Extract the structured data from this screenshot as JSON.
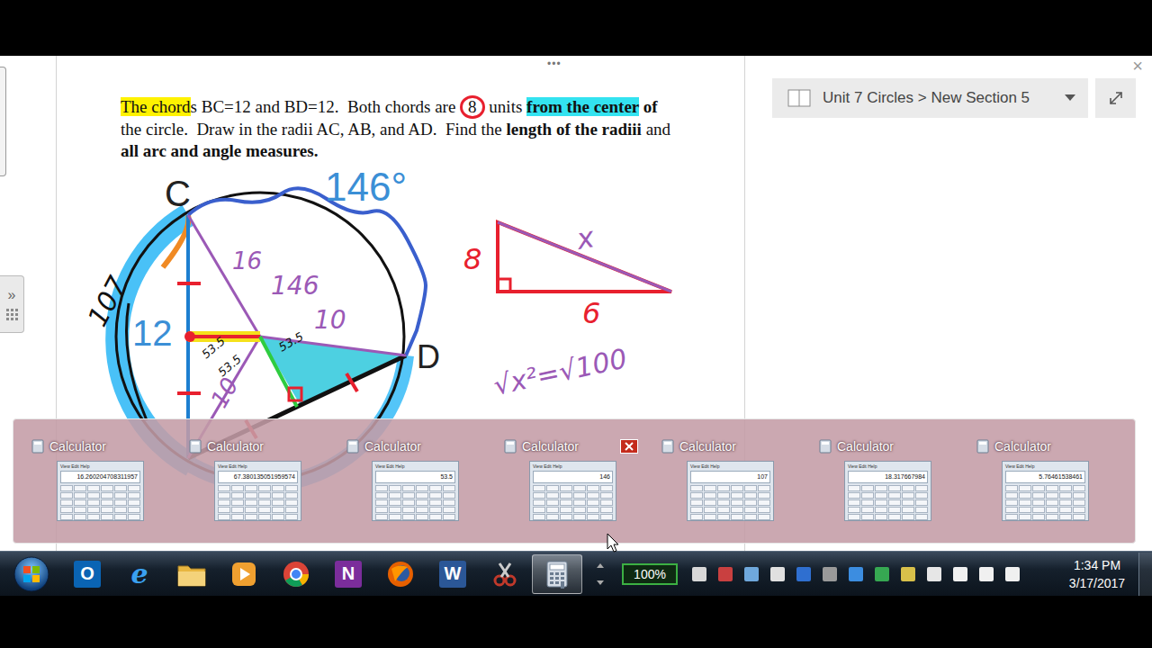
{
  "window": {
    "more": "•••",
    "close": "×",
    "expand_glyph": "»"
  },
  "problem": {
    "segments": [
      {
        "text": "The chord",
        "highlight": "yellow",
        "bold": false,
        "circled": false
      },
      {
        "text": "s BC=12 and BD=12.  Both chords are ",
        "highlight": "none",
        "bold": false,
        "circled": false
      },
      {
        "text": "8",
        "highlight": "none",
        "bold": false,
        "circled": true
      },
      {
        "text": " units ",
        "highlight": "none",
        "bold": false,
        "circled": false
      },
      {
        "text": "from the center",
        "highlight": "cyan",
        "bold": true,
        "circled": false
      },
      {
        "text": " of",
        "highlight": "none",
        "bold": true,
        "circled": false
      },
      {
        "text": " the circle.  Draw in the radii AC, AB, and AD.  Find the ",
        "highlight": "none",
        "bold": false,
        "circled": false
      },
      {
        "text": "length of the radiii",
        "highlight": "none",
        "bold": true,
        "circled": false
      },
      {
        "text": " and ",
        "highlight": "none",
        "bold": false,
        "circled": false
      },
      {
        "text": "all arc and angle measures.",
        "highlight": "none",
        "bold": true,
        "circled": false
      }
    ]
  },
  "diagram": {
    "labels": [
      {
        "text": "C"
      },
      {
        "text": "D"
      },
      {
        "text": "146°"
      },
      {
        "text": "12"
      }
    ],
    "annotations": [
      {
        "text": "107",
        "color": "#111111"
      },
      {
        "text": "16",
        "color": "#9b59b6"
      },
      {
        "text": "146",
        "color": "#9b59b6"
      },
      {
        "text": "10",
        "color": "#9b59b6"
      },
      {
        "text": "10",
        "color": "#9b59b6"
      },
      {
        "text": "53.5",
        "color": "#111111"
      },
      {
        "text": "53.5",
        "color": "#111111"
      },
      {
        "text": "53.5",
        "color": "#111111"
      },
      {
        "text": "8",
        "color": "#e8202e"
      },
      {
        "text": "x",
        "color": "#9b59b6"
      },
      {
        "text": "6",
        "color": "#e8202e"
      },
      {
        "text": "√x²=√100",
        "color": "#9b59b6"
      }
    ]
  },
  "breadcrumb": {
    "text": "Unit 7 Circles > New Section 5"
  },
  "thumbnail_menu": "View Edit Help",
  "thumbnails": [
    {
      "title": "Calculator",
      "display": "16.260204708311957",
      "hovered": false
    },
    {
      "title": "Calculator",
      "display": "67.380135051959574",
      "hovered": false
    },
    {
      "title": "Calculator",
      "display": "53.5",
      "hovered": false
    },
    {
      "title": "Calculator",
      "display": "146",
      "hovered": true
    },
    {
      "title": "Calculator",
      "display": "107",
      "hovered": false
    },
    {
      "title": "Calculator",
      "display": "18.317667984",
      "hovered": false
    },
    {
      "title": "Calculator",
      "display": "5.76461538461",
      "hovered": false
    }
  ],
  "taskbar": {
    "apps": [
      {
        "kind": "outlook",
        "glyph": "O",
        "active": false
      },
      {
        "kind": "ie",
        "glyph": "e",
        "active": false
      },
      {
        "kind": "explorer",
        "glyph": "",
        "active": false
      },
      {
        "kind": "media",
        "glyph": "",
        "active": false
      },
      {
        "kind": "chrome",
        "glyph": "",
        "active": false
      },
      {
        "kind": "onenote",
        "glyph": "N",
        "active": false
      },
      {
        "kind": "firefox",
        "glyph": "",
        "active": false
      },
      {
        "kind": "word",
        "glyph": "W",
        "active": false
      },
      {
        "kind": "snipping",
        "glyph": "",
        "active": false
      },
      {
        "kind": "calculator",
        "glyph": "",
        "active": true
      }
    ],
    "battery": "100%",
    "tray": [
      {
        "kind": "power"
      },
      {
        "kind": "keyboard"
      },
      {
        "kind": "book"
      },
      {
        "kind": "flag"
      },
      {
        "kind": "bluetooth"
      },
      {
        "kind": "network"
      },
      {
        "kind": "update"
      },
      {
        "kind": "shield"
      },
      {
        "kind": "security"
      },
      {
        "kind": "usb"
      },
      {
        "kind": "sync"
      },
      {
        "kind": "volume"
      },
      {
        "kind": "signal"
      }
    ],
    "time": "1:34 PM",
    "date": "3/17/2017"
  }
}
